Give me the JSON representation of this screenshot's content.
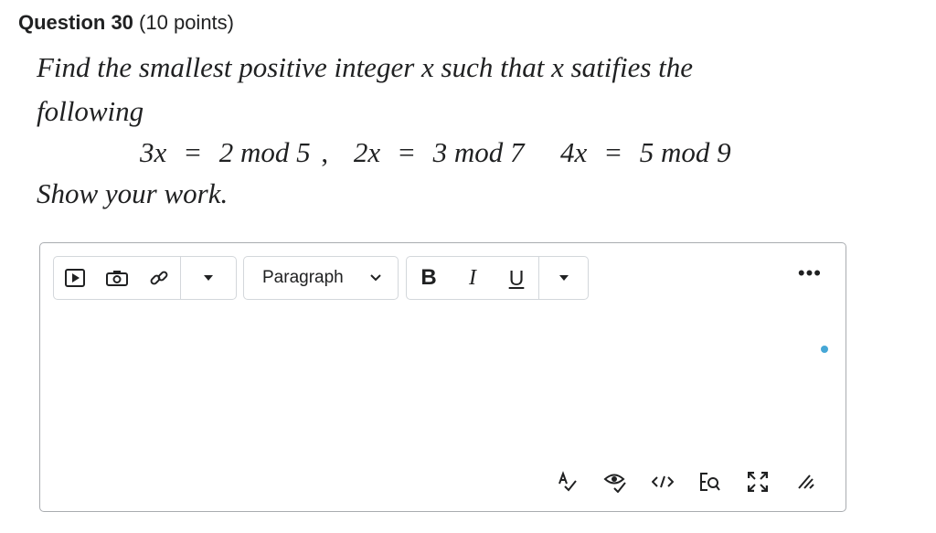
{
  "question": {
    "number": "Question 30",
    "points": "(10 points)",
    "prompt_line1": "Find the smallest positive integer x such that x satifies the",
    "prompt_line2": "following",
    "eq1_lhs": "3x",
    "eq1_rhs": "2 mod 5",
    "eq2_lhs": "2x",
    "eq2_rhs": "3 mod 7",
    "eq3_lhs": "4x",
    "eq3_rhs": "5 mod 9",
    "equals": "=",
    "comma": ",",
    "show_work": "Show your work."
  },
  "toolbar": {
    "paragraph_label": "Paragraph",
    "bold_label": "B",
    "italic_label": "I",
    "underline_label": "U",
    "more_label": "•••",
    "icons_group1": [
      "video-icon",
      "camera-icon",
      "link-icon",
      "dropdown-arrow-icon"
    ],
    "icons_group3": [
      "bold-icon",
      "italic-icon",
      "underline-icon",
      "dropdown-arrow-icon"
    ],
    "bottom_icons": [
      "spellcheck-icon",
      "accessibility-check-icon",
      "code-view-icon",
      "find-replace-icon",
      "fullscreen-icon",
      "resize-handle-icon"
    ],
    "status_dot_color": "#46a7d6"
  }
}
